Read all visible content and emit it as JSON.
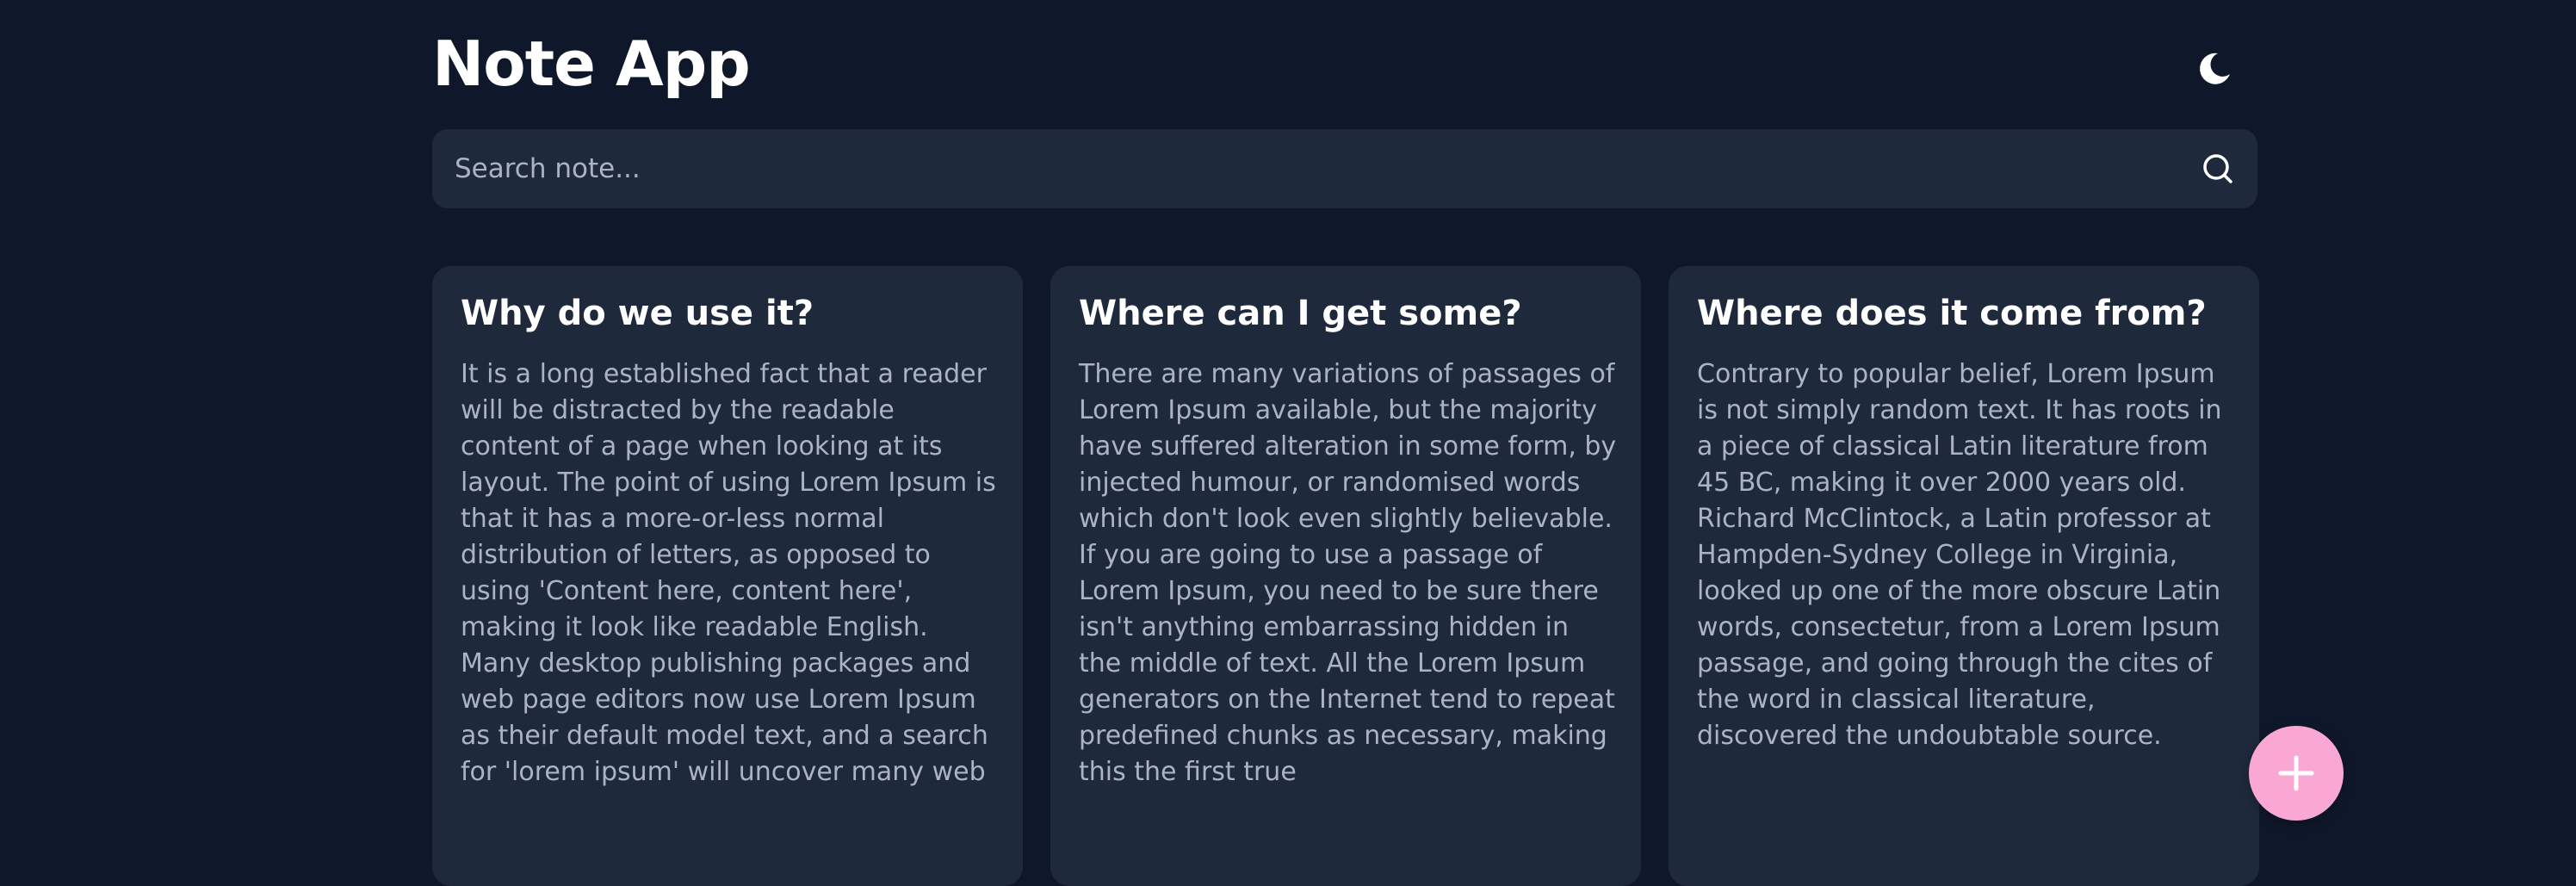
{
  "header": {
    "title": "Note App",
    "theme_icon": "moon-icon"
  },
  "search": {
    "placeholder": "Search note...",
    "value": "",
    "icon": "search-icon"
  },
  "notes": [
    {
      "title": "Why do we use it?",
      "body": "It is a long established fact that a reader will be distracted by the readable content of a page when looking at its layout. The point of using Lorem Ipsum is that it has a more-or-less normal distribution of letters, as opposed to using 'Content here, content here', making it look like readable English. Many desktop publishing packages and web page editors now use Lorem Ipsum as their default model text, and a search for 'lorem ipsum' will uncover many web"
    },
    {
      "title": "Where can I get some?",
      "body": "There are many variations of passages of Lorem Ipsum available, but the majority have suffered alteration in some form, by injected humour, or randomised words which don't look even slightly believable. If you are going to use a passage of Lorem Ipsum, you need to be sure there isn't anything embarrassing hidden in the middle of text. All the Lorem Ipsum generators on the Internet tend to repeat predefined chunks as necessary, making this the first true"
    },
    {
      "title": "Where does it come from?",
      "body": "Contrary to popular belief, Lorem Ipsum is not simply random text. It has roots in a piece of classical Latin literature from 45 BC, making it over 2000 years old. Richard McClintock, a Latin professor at Hampden-Sydney College in Virginia, looked up one of the more obscure Latin words, consectetur, from a Lorem Ipsum passage, and going through the cites of the word in classical literature, discovered the undoubtable source."
    }
  ],
  "fab": {
    "icon": "plus-icon"
  },
  "colors": {
    "background": "#0f172a",
    "surface": "#1e293b",
    "text": "#ffffff",
    "muted_text": "#aab4c3",
    "accent": "#f9a8d4"
  }
}
